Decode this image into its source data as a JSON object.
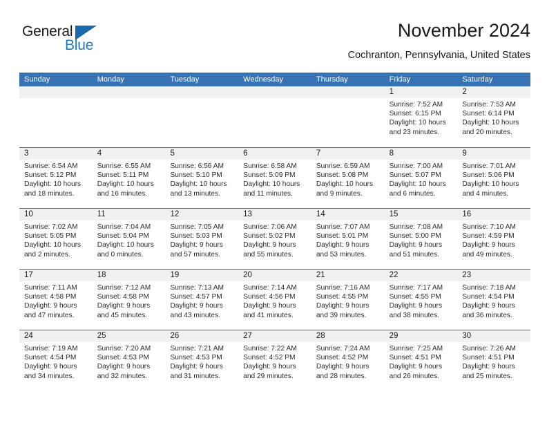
{
  "brand": {
    "name_part1": "General",
    "name_part2": "Blue",
    "triangle_color": "#1b68ad",
    "blue_text_color": "#1f7ac4"
  },
  "header": {
    "title": "November 2024",
    "location": "Cochranton, Pennsylvania, United States"
  },
  "theme": {
    "header_bar_color": "#3773b4",
    "row_divider_color": "#3773b4",
    "daynum_band_color": "#f0f0f0"
  },
  "calendar": {
    "weekday_headers": [
      "Sunday",
      "Monday",
      "Tuesday",
      "Wednesday",
      "Thursday",
      "Friday",
      "Saturday"
    ],
    "labels": {
      "sunrise": "Sunrise:",
      "sunset": "Sunset:",
      "daylight": "Daylight:"
    },
    "weeks": [
      [
        {
          "day": "",
          "empty": true,
          "sunrise": "",
          "sunset": "",
          "daylight_l1": "",
          "daylight_l2": ""
        },
        {
          "day": "",
          "empty": true,
          "sunrise": "",
          "sunset": "",
          "daylight_l1": "",
          "daylight_l2": ""
        },
        {
          "day": "",
          "empty": true,
          "sunrise": "",
          "sunset": "",
          "daylight_l1": "",
          "daylight_l2": ""
        },
        {
          "day": "",
          "empty": true,
          "sunrise": "",
          "sunset": "",
          "daylight_l1": "",
          "daylight_l2": ""
        },
        {
          "day": "",
          "empty": true,
          "sunrise": "",
          "sunset": "",
          "daylight_l1": "",
          "daylight_l2": ""
        },
        {
          "day": "1",
          "empty": false,
          "sunrise": "Sunrise: 7:52 AM",
          "sunset": "Sunset: 6:15 PM",
          "daylight_l1": "Daylight: 10 hours",
          "daylight_l2": "and 23 minutes."
        },
        {
          "day": "2",
          "empty": false,
          "sunrise": "Sunrise: 7:53 AM",
          "sunset": "Sunset: 6:14 PM",
          "daylight_l1": "Daylight: 10 hours",
          "daylight_l2": "and 20 minutes."
        }
      ],
      [
        {
          "day": "3",
          "empty": false,
          "sunrise": "Sunrise: 6:54 AM",
          "sunset": "Sunset: 5:12 PM",
          "daylight_l1": "Daylight: 10 hours",
          "daylight_l2": "and 18 minutes."
        },
        {
          "day": "4",
          "empty": false,
          "sunrise": "Sunrise: 6:55 AM",
          "sunset": "Sunset: 5:11 PM",
          "daylight_l1": "Daylight: 10 hours",
          "daylight_l2": "and 16 minutes."
        },
        {
          "day": "5",
          "empty": false,
          "sunrise": "Sunrise: 6:56 AM",
          "sunset": "Sunset: 5:10 PM",
          "daylight_l1": "Daylight: 10 hours",
          "daylight_l2": "and 13 minutes."
        },
        {
          "day": "6",
          "empty": false,
          "sunrise": "Sunrise: 6:58 AM",
          "sunset": "Sunset: 5:09 PM",
          "daylight_l1": "Daylight: 10 hours",
          "daylight_l2": "and 11 minutes."
        },
        {
          "day": "7",
          "empty": false,
          "sunrise": "Sunrise: 6:59 AM",
          "sunset": "Sunset: 5:08 PM",
          "daylight_l1": "Daylight: 10 hours",
          "daylight_l2": "and 9 minutes."
        },
        {
          "day": "8",
          "empty": false,
          "sunrise": "Sunrise: 7:00 AM",
          "sunset": "Sunset: 5:07 PM",
          "daylight_l1": "Daylight: 10 hours",
          "daylight_l2": "and 6 minutes."
        },
        {
          "day": "9",
          "empty": false,
          "sunrise": "Sunrise: 7:01 AM",
          "sunset": "Sunset: 5:06 PM",
          "daylight_l1": "Daylight: 10 hours",
          "daylight_l2": "and 4 minutes."
        }
      ],
      [
        {
          "day": "10",
          "empty": false,
          "sunrise": "Sunrise: 7:02 AM",
          "sunset": "Sunset: 5:05 PM",
          "daylight_l1": "Daylight: 10 hours",
          "daylight_l2": "and 2 minutes."
        },
        {
          "day": "11",
          "empty": false,
          "sunrise": "Sunrise: 7:04 AM",
          "sunset": "Sunset: 5:04 PM",
          "daylight_l1": "Daylight: 10 hours",
          "daylight_l2": "and 0 minutes."
        },
        {
          "day": "12",
          "empty": false,
          "sunrise": "Sunrise: 7:05 AM",
          "sunset": "Sunset: 5:03 PM",
          "daylight_l1": "Daylight: 9 hours",
          "daylight_l2": "and 57 minutes."
        },
        {
          "day": "13",
          "empty": false,
          "sunrise": "Sunrise: 7:06 AM",
          "sunset": "Sunset: 5:02 PM",
          "daylight_l1": "Daylight: 9 hours",
          "daylight_l2": "and 55 minutes."
        },
        {
          "day": "14",
          "empty": false,
          "sunrise": "Sunrise: 7:07 AM",
          "sunset": "Sunset: 5:01 PM",
          "daylight_l1": "Daylight: 9 hours",
          "daylight_l2": "and 53 minutes."
        },
        {
          "day": "15",
          "empty": false,
          "sunrise": "Sunrise: 7:08 AM",
          "sunset": "Sunset: 5:00 PM",
          "daylight_l1": "Daylight: 9 hours",
          "daylight_l2": "and 51 minutes."
        },
        {
          "day": "16",
          "empty": false,
          "sunrise": "Sunrise: 7:10 AM",
          "sunset": "Sunset: 4:59 PM",
          "daylight_l1": "Daylight: 9 hours",
          "daylight_l2": "and 49 minutes."
        }
      ],
      [
        {
          "day": "17",
          "empty": false,
          "sunrise": "Sunrise: 7:11 AM",
          "sunset": "Sunset: 4:58 PM",
          "daylight_l1": "Daylight: 9 hours",
          "daylight_l2": "and 47 minutes."
        },
        {
          "day": "18",
          "empty": false,
          "sunrise": "Sunrise: 7:12 AM",
          "sunset": "Sunset: 4:58 PM",
          "daylight_l1": "Daylight: 9 hours",
          "daylight_l2": "and 45 minutes."
        },
        {
          "day": "19",
          "empty": false,
          "sunrise": "Sunrise: 7:13 AM",
          "sunset": "Sunset: 4:57 PM",
          "daylight_l1": "Daylight: 9 hours",
          "daylight_l2": "and 43 minutes."
        },
        {
          "day": "20",
          "empty": false,
          "sunrise": "Sunrise: 7:14 AM",
          "sunset": "Sunset: 4:56 PM",
          "daylight_l1": "Daylight: 9 hours",
          "daylight_l2": "and 41 minutes."
        },
        {
          "day": "21",
          "empty": false,
          "sunrise": "Sunrise: 7:16 AM",
          "sunset": "Sunset: 4:55 PM",
          "daylight_l1": "Daylight: 9 hours",
          "daylight_l2": "and 39 minutes."
        },
        {
          "day": "22",
          "empty": false,
          "sunrise": "Sunrise: 7:17 AM",
          "sunset": "Sunset: 4:55 PM",
          "daylight_l1": "Daylight: 9 hours",
          "daylight_l2": "and 38 minutes."
        },
        {
          "day": "23",
          "empty": false,
          "sunrise": "Sunrise: 7:18 AM",
          "sunset": "Sunset: 4:54 PM",
          "daylight_l1": "Daylight: 9 hours",
          "daylight_l2": "and 36 minutes."
        }
      ],
      [
        {
          "day": "24",
          "empty": false,
          "sunrise": "Sunrise: 7:19 AM",
          "sunset": "Sunset: 4:54 PM",
          "daylight_l1": "Daylight: 9 hours",
          "daylight_l2": "and 34 minutes."
        },
        {
          "day": "25",
          "empty": false,
          "sunrise": "Sunrise: 7:20 AM",
          "sunset": "Sunset: 4:53 PM",
          "daylight_l1": "Daylight: 9 hours",
          "daylight_l2": "and 32 minutes."
        },
        {
          "day": "26",
          "empty": false,
          "sunrise": "Sunrise: 7:21 AM",
          "sunset": "Sunset: 4:53 PM",
          "daylight_l1": "Daylight: 9 hours",
          "daylight_l2": "and 31 minutes."
        },
        {
          "day": "27",
          "empty": false,
          "sunrise": "Sunrise: 7:22 AM",
          "sunset": "Sunset: 4:52 PM",
          "daylight_l1": "Daylight: 9 hours",
          "daylight_l2": "and 29 minutes."
        },
        {
          "day": "28",
          "empty": false,
          "sunrise": "Sunrise: 7:24 AM",
          "sunset": "Sunset: 4:52 PM",
          "daylight_l1": "Daylight: 9 hours",
          "daylight_l2": "and 28 minutes."
        },
        {
          "day": "29",
          "empty": false,
          "sunrise": "Sunrise: 7:25 AM",
          "sunset": "Sunset: 4:51 PM",
          "daylight_l1": "Daylight: 9 hours",
          "daylight_l2": "and 26 minutes."
        },
        {
          "day": "30",
          "empty": false,
          "sunrise": "Sunrise: 7:26 AM",
          "sunset": "Sunset: 4:51 PM",
          "daylight_l1": "Daylight: 9 hours",
          "daylight_l2": "and 25 minutes."
        }
      ]
    ]
  }
}
